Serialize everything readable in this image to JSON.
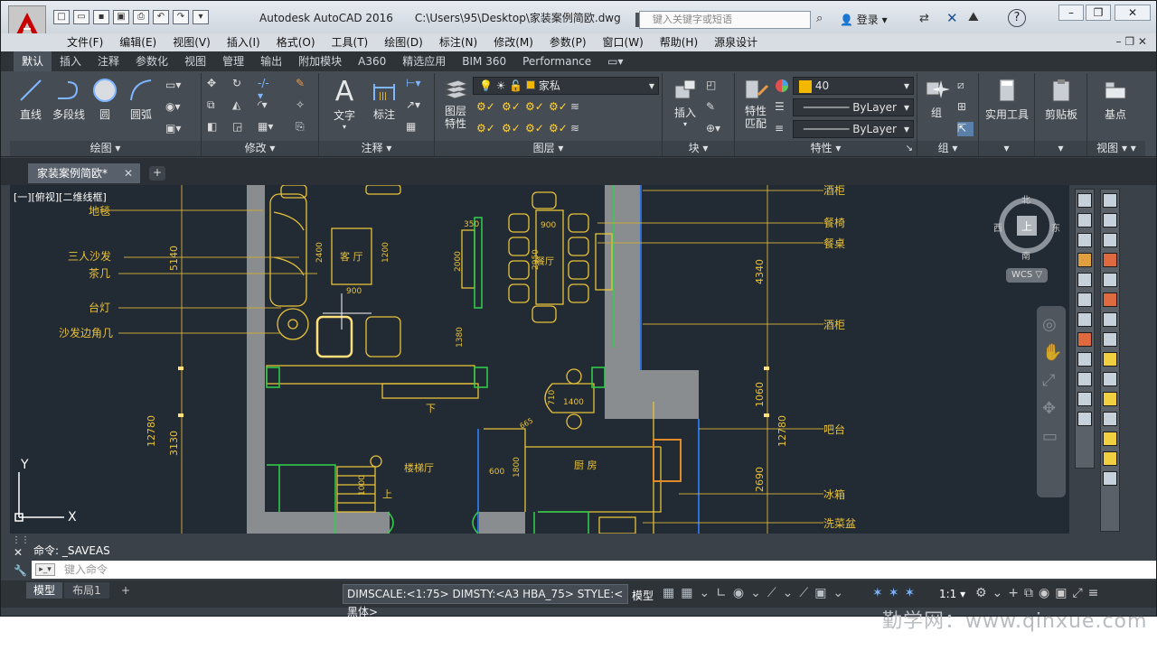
{
  "title": {
    "app": "Autodesk AutoCAD 2016",
    "file": "C:\\Users\\95\\Desktop\\家装案例简欧.dwg",
    "search_placeholder": "键入关键字或短语",
    "login": "登录"
  },
  "menu": [
    "文件(F)",
    "编辑(E)",
    "视图(V)",
    "插入(I)",
    "格式(O)",
    "工具(T)",
    "绘图(D)",
    "标注(N)",
    "修改(M)",
    "参数(P)",
    "窗口(W)",
    "帮助(H)",
    "源泉设计"
  ],
  "ribbon_tabs": [
    "默认",
    "插入",
    "注释",
    "参数化",
    "视图",
    "管理",
    "输出",
    "附加模块",
    "A360",
    "精选应用",
    "BIM 360",
    "Performance"
  ],
  "ribbon": {
    "draw": {
      "title": "绘图",
      "line": "直线",
      "polyline": "多段线",
      "circle": "圆",
      "arc": "圆弧"
    },
    "modify": {
      "title": "修改"
    },
    "annotation": {
      "title": "注释",
      "text": "文字",
      "dimension": "标注"
    },
    "layers": {
      "title": "图层",
      "props": "图层\n特性",
      "layer_name": "家私"
    },
    "block": {
      "title": "块",
      "insert": "插入"
    },
    "properties": {
      "title": "特性",
      "match": "特性\n匹配",
      "color": "40",
      "linetype": "ByLayer",
      "lineweight": "ByLayer"
    },
    "groups": {
      "title": "组",
      "group": "组"
    },
    "utilities": {
      "title": "",
      "label": "实用工具"
    },
    "clipboard": {
      "label": "剪贴板"
    },
    "view": {
      "title": "视图",
      "base": "基点"
    }
  },
  "document_tab": "家装案例简欧*",
  "viewport_label": "[一][俯视][二维线框]",
  "viewcube": {
    "north": "北",
    "south": "南",
    "east": "东",
    "west": "西",
    "top": "上",
    "wcs": "WCS"
  },
  "drawing": {
    "left_labels": [
      "地毯",
      "三人沙发",
      "茶几",
      "台灯",
      "沙发边角几"
    ],
    "right_labels": [
      "酒柜",
      "餐椅",
      "餐桌",
      "酒柜",
      "吧台",
      "冰箱",
      "洗菜盆"
    ],
    "rooms": [
      "客 厅",
      "餐厅",
      "楼梯厅",
      "厨 房"
    ],
    "dims": [
      "5140",
      "12780",
      "3130",
      "2400",
      "1200",
      "900",
      "2000",
      "350",
      "900",
      "2950",
      "1380",
      "4340",
      "1060",
      "12780",
      "2690",
      "1400",
      "710",
      "600",
      "1800",
      "1000",
      "665"
    ],
    "stair": [
      "下",
      "上"
    ]
  },
  "command": {
    "history": "命令:  _SAVEAS",
    "prompt": "键入命令"
  },
  "layout_tabs": [
    "模型",
    "布局1"
  ],
  "status": {
    "dim": "DIMSCALE:<1:75> DIMSTY:<A3 HBA_75> STYLE:<黑体>",
    "model": "模型",
    "scale": "1:1"
  },
  "watermark": "勤学网：www.qinxue.com",
  "colors": {
    "accent": "#c60000",
    "drawing_yellow": "#e8c23a",
    "drawing_green": "#2fd14a",
    "wall_gray": "#8a8d90"
  }
}
